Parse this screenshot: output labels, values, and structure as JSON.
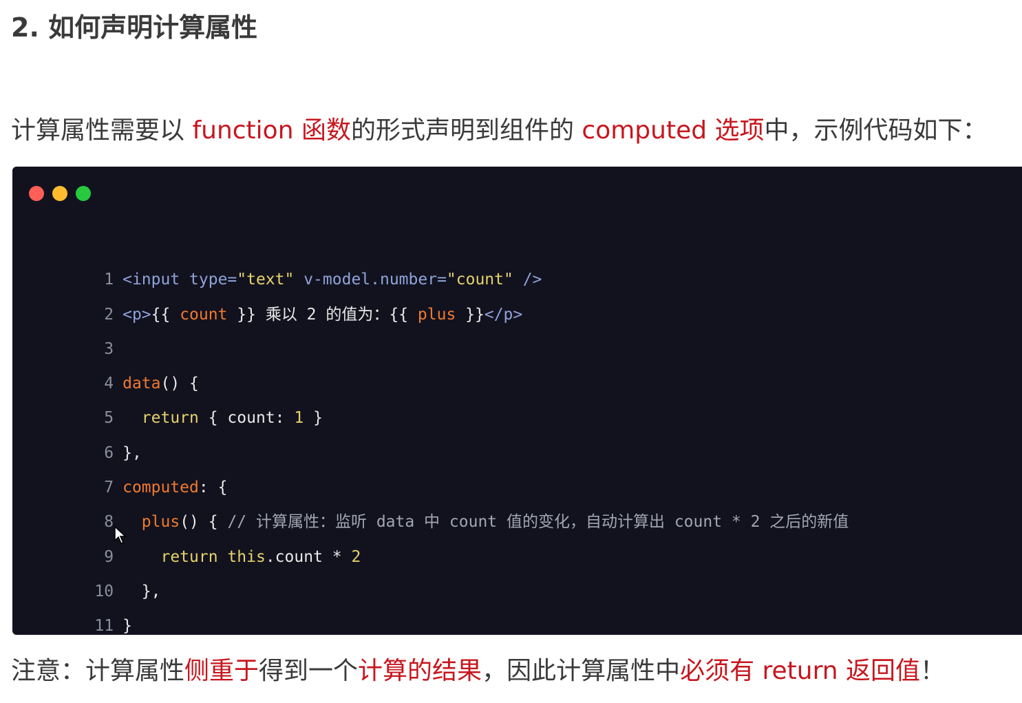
{
  "heading": "2. 如何声明计算属性",
  "intro": {
    "part1": "计算属性需要以 ",
    "red1": "function 函数",
    "part2": "的形式声明到组件的 ",
    "red2": "computed 选项",
    "part3": "中，示例代码如下："
  },
  "code": {
    "window_dots": [
      "close",
      "minimize",
      "maximize"
    ],
    "lines": [
      {
        "n": "1",
        "t": [
          "<input type=",
          "\"text\"",
          " v-model.number=",
          "\"count\"",
          " />"
        ]
      },
      {
        "n": "2",
        "t": [
          "<p>",
          "{{ ",
          "count",
          " }} 乘以 2 的值为：{{ ",
          "plus",
          " }}",
          "</p>"
        ]
      },
      {
        "n": "3",
        "t": []
      },
      {
        "n": "4",
        "t": [
          "data",
          "() {"
        ]
      },
      {
        "n": "5",
        "t": [
          "  ",
          "return",
          " { count: ",
          "1",
          " }"
        ]
      },
      {
        "n": "6",
        "t": [
          "},"
        ]
      },
      {
        "n": "7",
        "t": [
          "computed",
          ": {"
        ]
      },
      {
        "n": "8",
        "t": [
          "  ",
          "plus",
          "() { ",
          "// 计算属性：监听 data 中 count 值的变化，自动计算出 count * 2 之后的新值"
        ]
      },
      {
        "n": "9",
        "t": [
          "    ",
          "return",
          " ",
          "this",
          ".count * ",
          "2"
        ]
      },
      {
        "n": "10",
        "t": [
          "  },"
        ]
      },
      {
        "n": "11",
        "t": [
          "}"
        ]
      }
    ]
  },
  "note": {
    "part1": "注意：计算属性",
    "red1": "侧重于",
    "part2": "得到一个",
    "red2": "计算的结果",
    "part3": "，因此计算属性中",
    "red3": "必须有 return 返回值",
    "part4": "！"
  }
}
